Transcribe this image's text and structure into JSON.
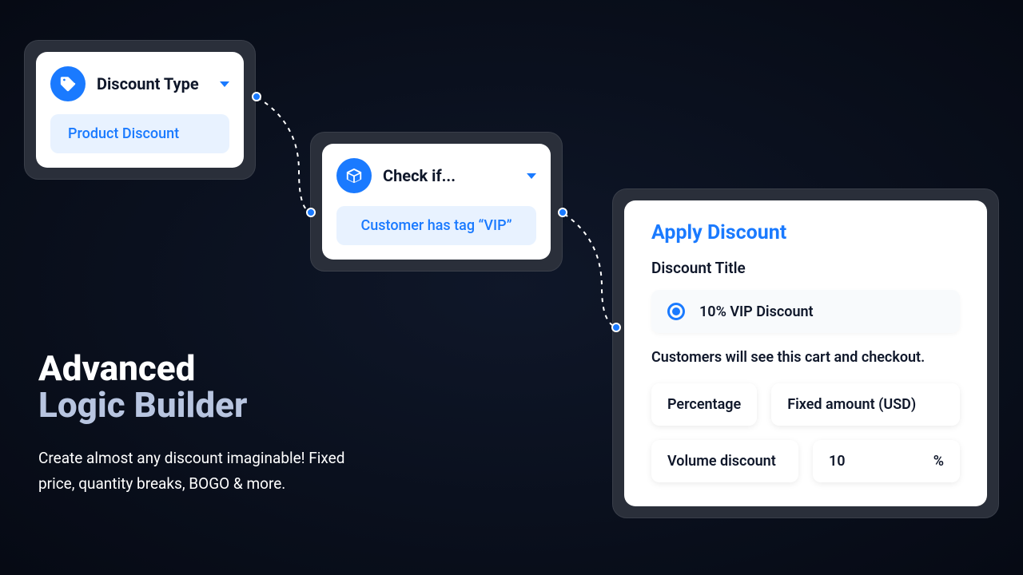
{
  "node1": {
    "title": "Discount Type",
    "pill": "Product Discount"
  },
  "node2": {
    "title": "Check if...",
    "pill": "Customer has tag “VIP”"
  },
  "node3": {
    "title": "Apply Discount",
    "discount_title_label": "Discount Title",
    "radio_option": "10% VIP Discount",
    "help": "Customers will see this cart and checkout.",
    "opt_percentage": "Percentage",
    "opt_fixed": "Fixed amount (USD)",
    "opt_volume": "Volume discount",
    "value": "10",
    "unit": "%"
  },
  "headline": {
    "line1": "Advanced",
    "line2": "Logic Builder",
    "sub": "Create almost any discount imaginable! Fixed price, quantity breaks, BOGO & more."
  }
}
